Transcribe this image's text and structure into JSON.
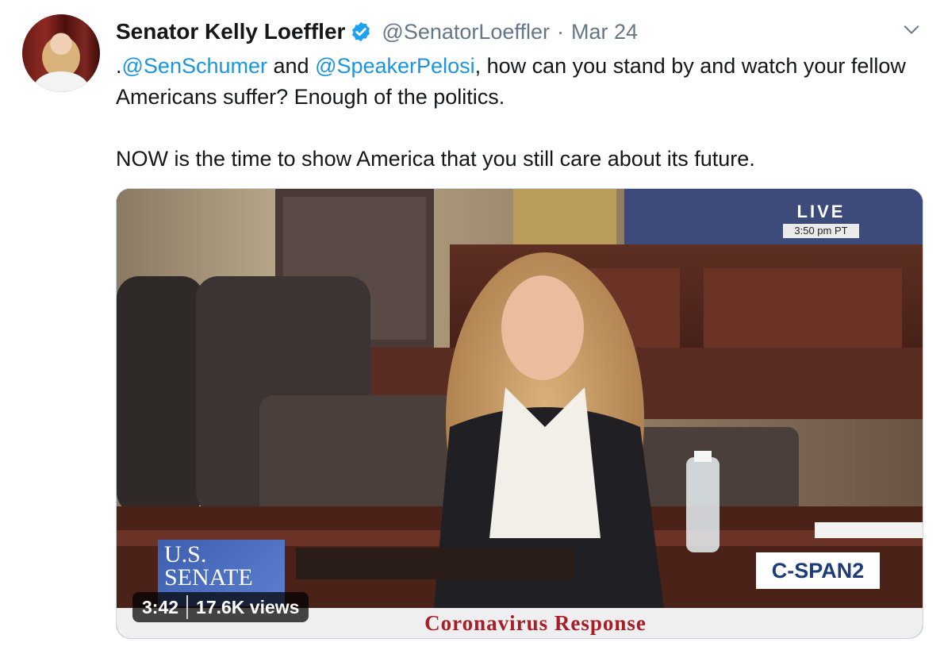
{
  "tweet": {
    "author_name": "Senator Kelly Loeffler",
    "handle": "@SenatorLoeffler",
    "separator": "·",
    "date": "Mar 24",
    "text": {
      "prefix": ".",
      "mention_1": "@SenSchumer",
      "connector": " and ",
      "mention_2": "@SpeakerPelosi",
      "rest_line_1": ", how can you stand by and watch your fellow Americans suffer? Enough of the politics.",
      "paragraph_2": "NOW is the time to show America that you still care about its future."
    },
    "colors": {
      "mention": "#1b95e0",
      "verified": "#1da1f2",
      "secondary_text": "#657786"
    },
    "icons": {
      "verified": "verified-badge-icon",
      "menu": "chevron-down-icon"
    }
  },
  "media": {
    "live_label": "LIVE",
    "live_time": "3:50 pm PT",
    "senate_logo": {
      "line_1": "U.S.",
      "line_2": "SENATE"
    },
    "network_logo": "C-SPAN2",
    "banner": "Coronavirus Response",
    "duration": "3:42",
    "views": "17.6K views"
  }
}
